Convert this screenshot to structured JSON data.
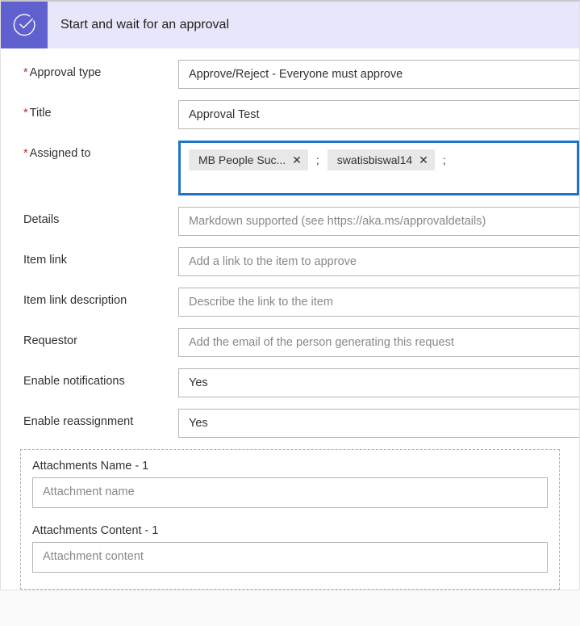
{
  "header": {
    "title": "Start and wait for an approval"
  },
  "fields": {
    "approval_type": {
      "label": "Approval type",
      "value": "Approve/Reject - Everyone must approve",
      "required": true
    },
    "title": {
      "label": "Title",
      "value": "Approval Test",
      "required": true
    },
    "assigned_to": {
      "label": "Assigned to",
      "required": true,
      "tokens": [
        {
          "display": "MB People Suc..."
        },
        {
          "display": "swatisbiswal14"
        }
      ],
      "separator": ";"
    },
    "details": {
      "label": "Details",
      "placeholder": "Markdown supported (see https://aka.ms/approvaldetails)"
    },
    "item_link": {
      "label": "Item link",
      "placeholder": "Add a link to the item to approve"
    },
    "item_link_desc": {
      "label": "Item link description",
      "placeholder": "Describe the link to the item"
    },
    "requestor": {
      "label": "Requestor",
      "placeholder": "Add the email of the person generating this request"
    },
    "enable_notifications": {
      "label": "Enable notifications",
      "value": "Yes"
    },
    "enable_reassignment": {
      "label": "Enable reassignment",
      "value": "Yes"
    }
  },
  "attachments": {
    "name": {
      "label": "Attachments Name - 1",
      "placeholder": "Attachment name"
    },
    "content": {
      "label": "Attachments Content - 1",
      "placeholder": "Attachment content"
    }
  }
}
